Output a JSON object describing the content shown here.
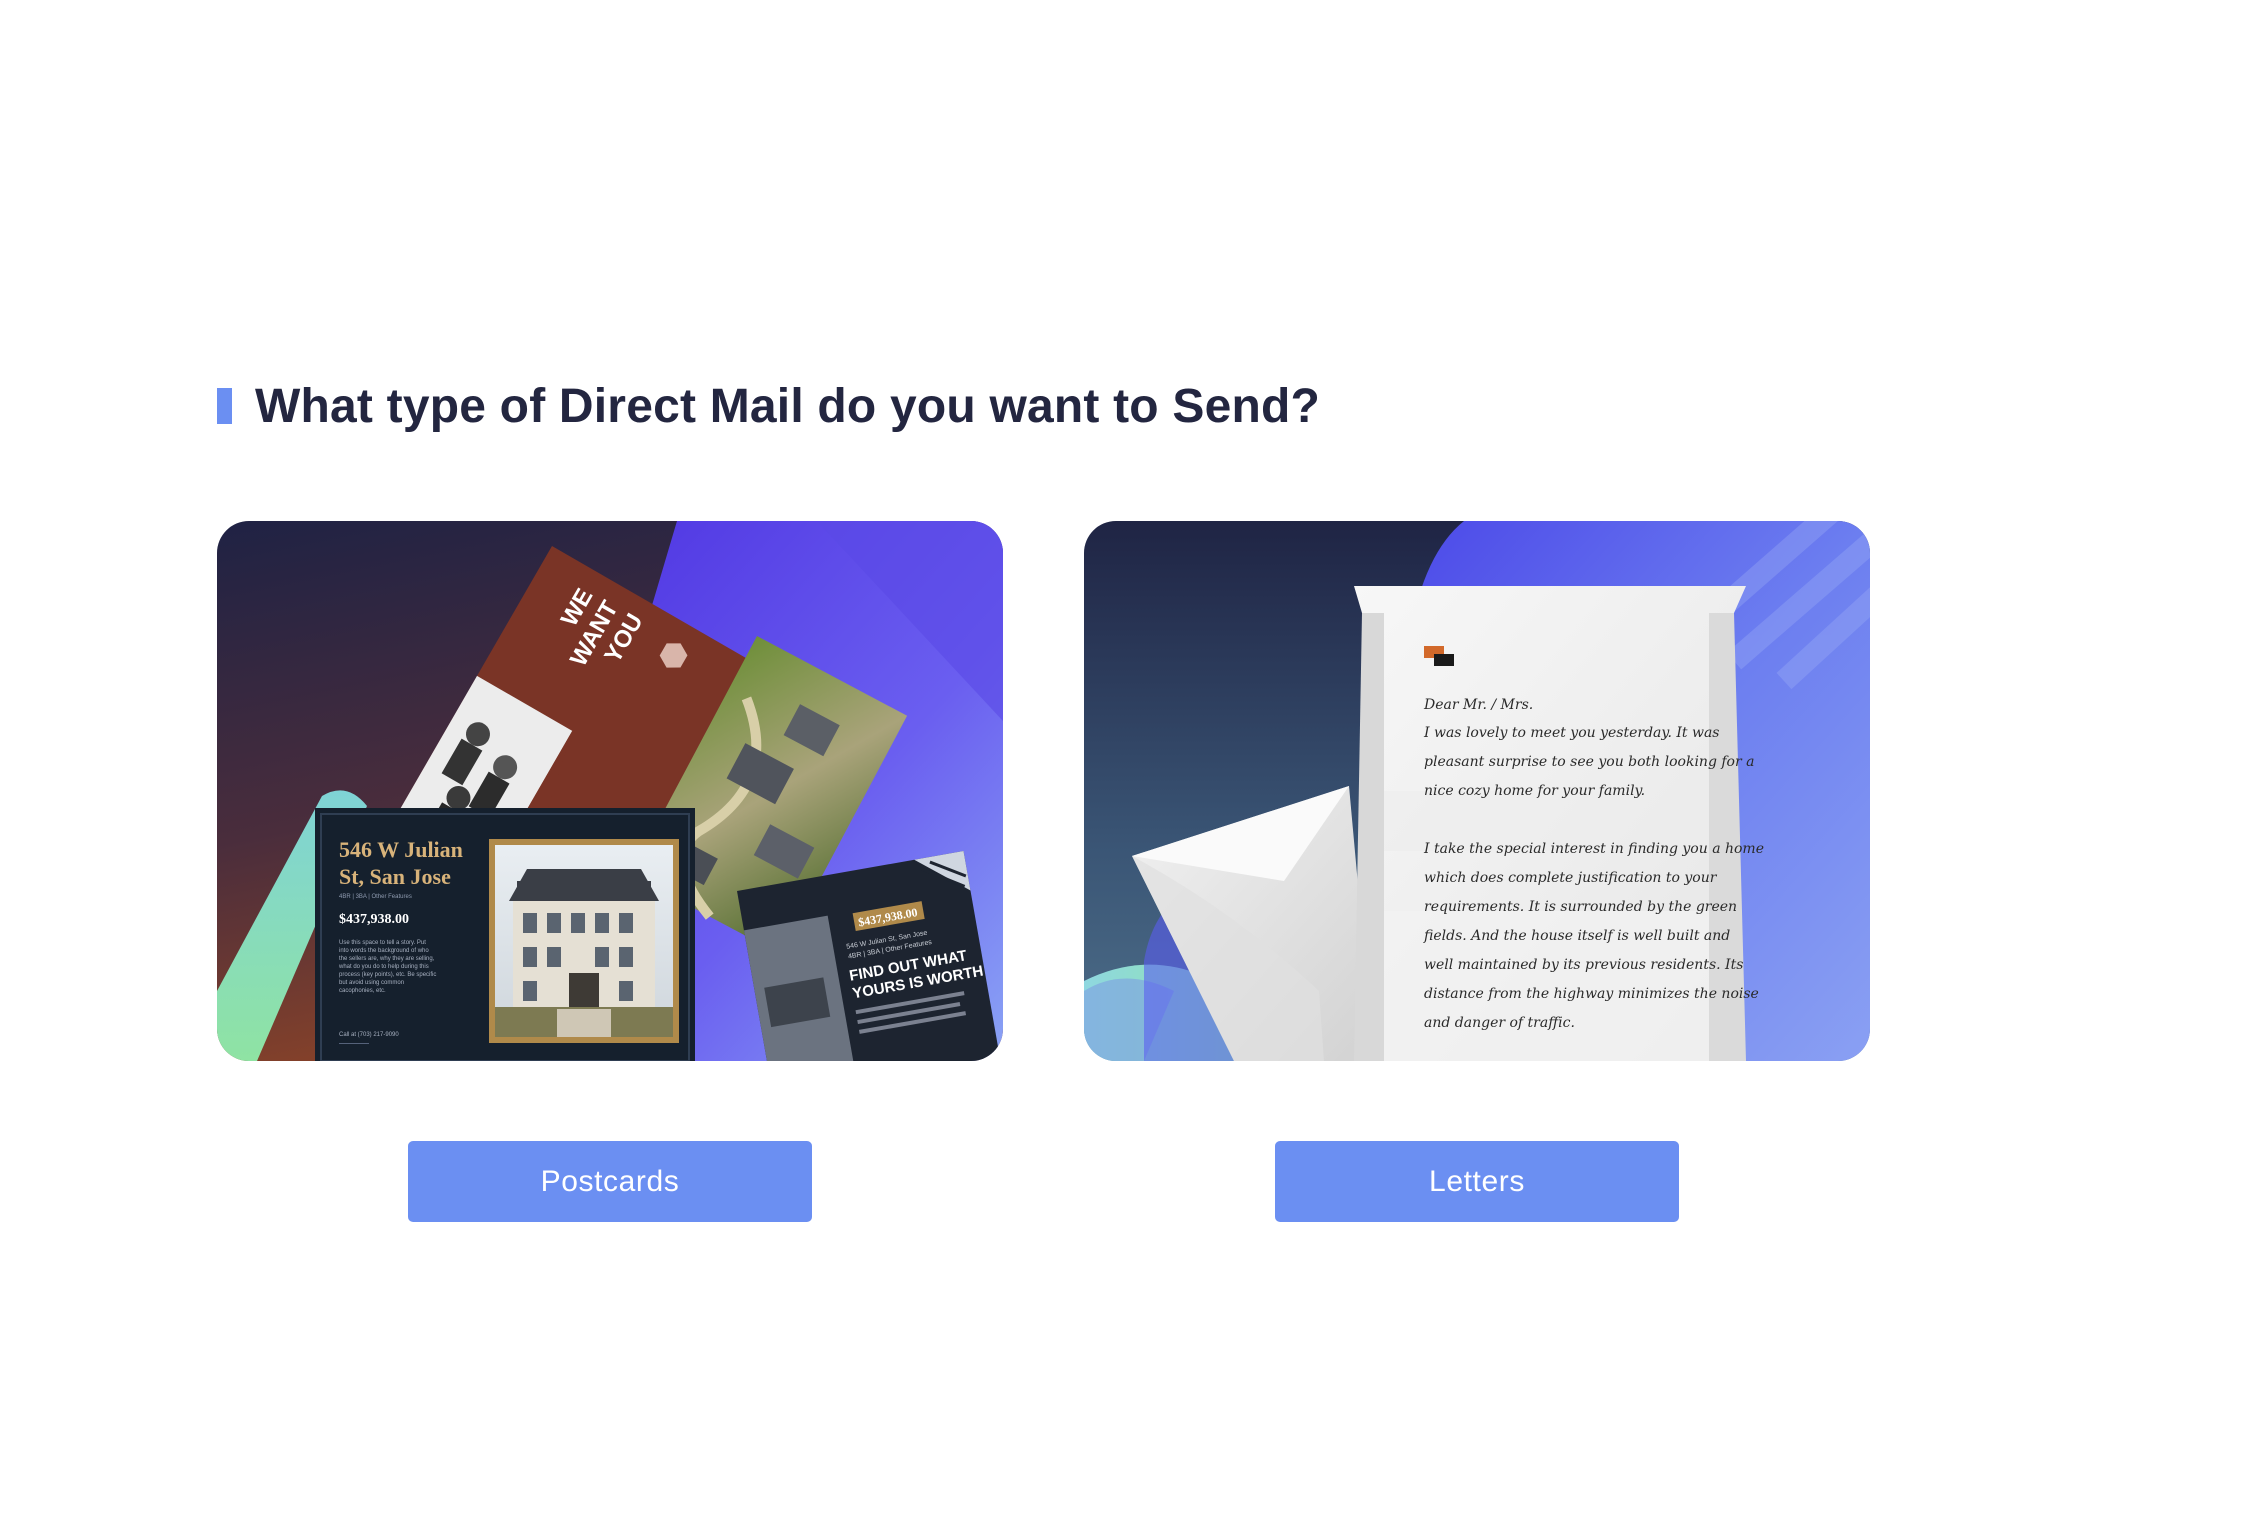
{
  "page": {
    "title": "What type of Direct Mail do you want to Send?"
  },
  "options": {
    "postcards": {
      "button_label": "Postcards",
      "card": {
        "we_want_you": [
          "WE",
          "WANT",
          "YOU"
        ],
        "address_line1": "546 W Julian",
        "address_line2": "St, San Jose",
        "features": "4BR | 3BA | Other Features",
        "price": "$437,938.00",
        "body_lines": [
          "Use this space to tell a story. Put",
          "into words the background of who",
          "the sellers are, why they are selling,",
          "what do you do to help during this",
          "process (key points), etc. Be specific",
          "but avoid using common",
          "cacophonies, etc."
        ],
        "call_line": "Call at (703) 217-9090",
        "find_out_line1": "FIND OUT WHAT",
        "find_out_line2": "YOURS IS WORTH",
        "find_out_price": "$437,938.00",
        "find_out_address": "546 W Julian St, San Jose",
        "find_out_features": "4BR | 3BA | Other Features"
      }
    },
    "letters": {
      "button_label": "Letters",
      "letter": {
        "salutation": "Dear Mr. / Mrs.",
        "lines": [
          "I was lovely to meet you yesterday. It was",
          "pleasant surprise to see you both looking for a",
          "nice cozy home for your family.",
          "",
          "I take the special interest in finding you a home",
          "which does complete justification to your",
          "requirements. It is surrounded by the green",
          "fields. And the house itself is well built and",
          "well maintained by its previous residents. Its",
          "distance from the highway minimizes the noise",
          "and danger of traffic."
        ]
      }
    }
  },
  "colors": {
    "accent": "#6b8ff2",
    "heading": "#232640",
    "button_text": "#ffffff"
  }
}
